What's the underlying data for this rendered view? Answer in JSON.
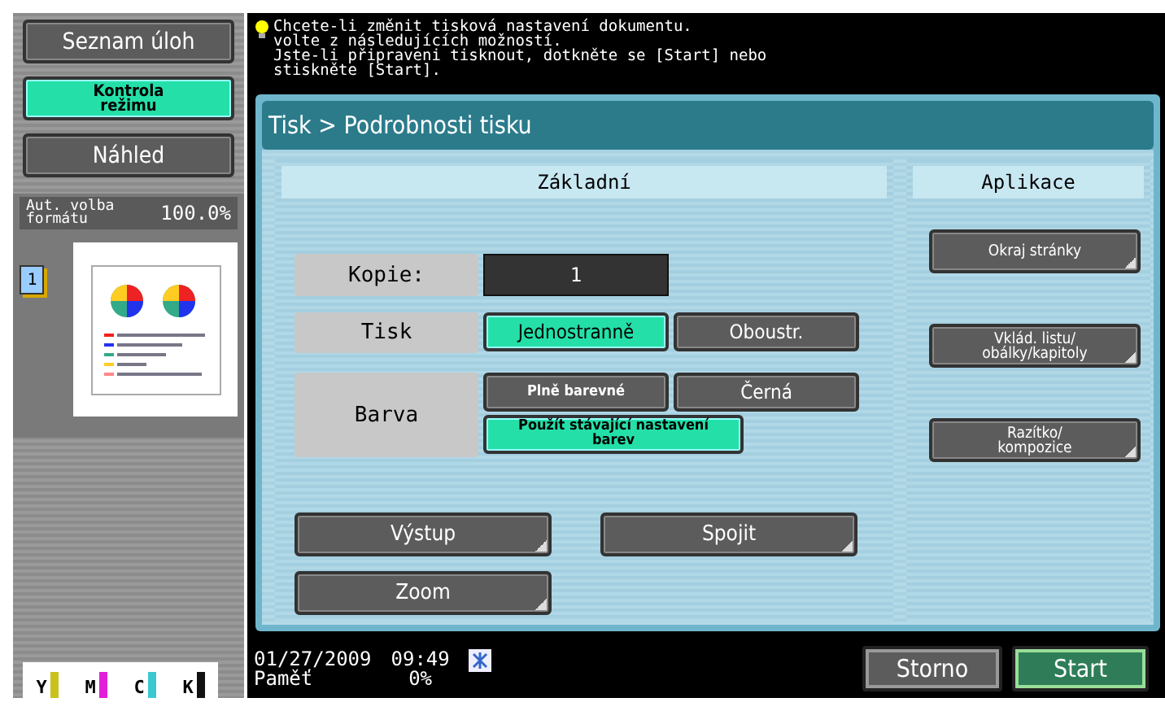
{
  "sidebar": {
    "buttons": [
      {
        "label": "Seznam úloh",
        "selected": false
      },
      {
        "label": "Kontrola režimu",
        "selected": true
      },
      {
        "label": "Náhled",
        "selected": false
      }
    ],
    "preview": {
      "label": "Aut. volba formátu",
      "zoom": "100.0%",
      "page_count": "1"
    },
    "toner": [
      {
        "label": "Y",
        "color": "#c8c21a",
        "level": 1
      },
      {
        "label": "M",
        "color": "#e020d8",
        "level": 1
      },
      {
        "label": "C",
        "color": "#3cc8d0",
        "level": 1
      },
      {
        "label": "K",
        "color": "#111111",
        "level": 1
      }
    ]
  },
  "message": {
    "lines": [
      "Chcete-li změnit tisková nastavení dokumentu.",
      "volte z následujících možností.",
      "Jste-li připraveni tisknout, dotkněte se [Start] nebo",
      "stiskněte [Start]."
    ]
  },
  "panel": {
    "title": "Tisk > Podrobnosti tisku",
    "basic": {
      "title": "Základní",
      "copies": {
        "label": "Kopie:",
        "value": "1"
      },
      "print": {
        "label": "Tisk",
        "options": [
          {
            "label": "Jednostranně",
            "selected": true
          },
          {
            "label": "Oboustr.",
            "selected": false
          }
        ]
      },
      "color": {
        "label": "Barva",
        "options": [
          {
            "label": "Plně barevné",
            "selected": false
          },
          {
            "label": "Černá",
            "selected": false
          },
          {
            "label": "Použít stávající nastavení barev",
            "selected": true
          }
        ]
      },
      "buttons": [
        {
          "label": "Výstup",
          "submenu": true
        },
        {
          "label": "Spojit",
          "submenu": true
        },
        {
          "label": "Zoom",
          "submenu": true
        }
      ]
    },
    "applications": {
      "title": "Aplikace",
      "buttons": [
        {
          "label": "Okraj stránky",
          "submenu": true
        },
        {
          "label": "Vklád. listu/ obálky/kapitoly",
          "submenu": true
        },
        {
          "label": "Razítko/ kompozice",
          "submenu": true
        }
      ]
    }
  },
  "status_bar": {
    "date": "01/27/2009",
    "time": "09:49",
    "memory_label": "Paměť",
    "memory": "0%"
  },
  "actions": [
    {
      "label": "Storno",
      "kind": "cancel"
    },
    {
      "label": "Start",
      "kind": "start"
    }
  ]
}
